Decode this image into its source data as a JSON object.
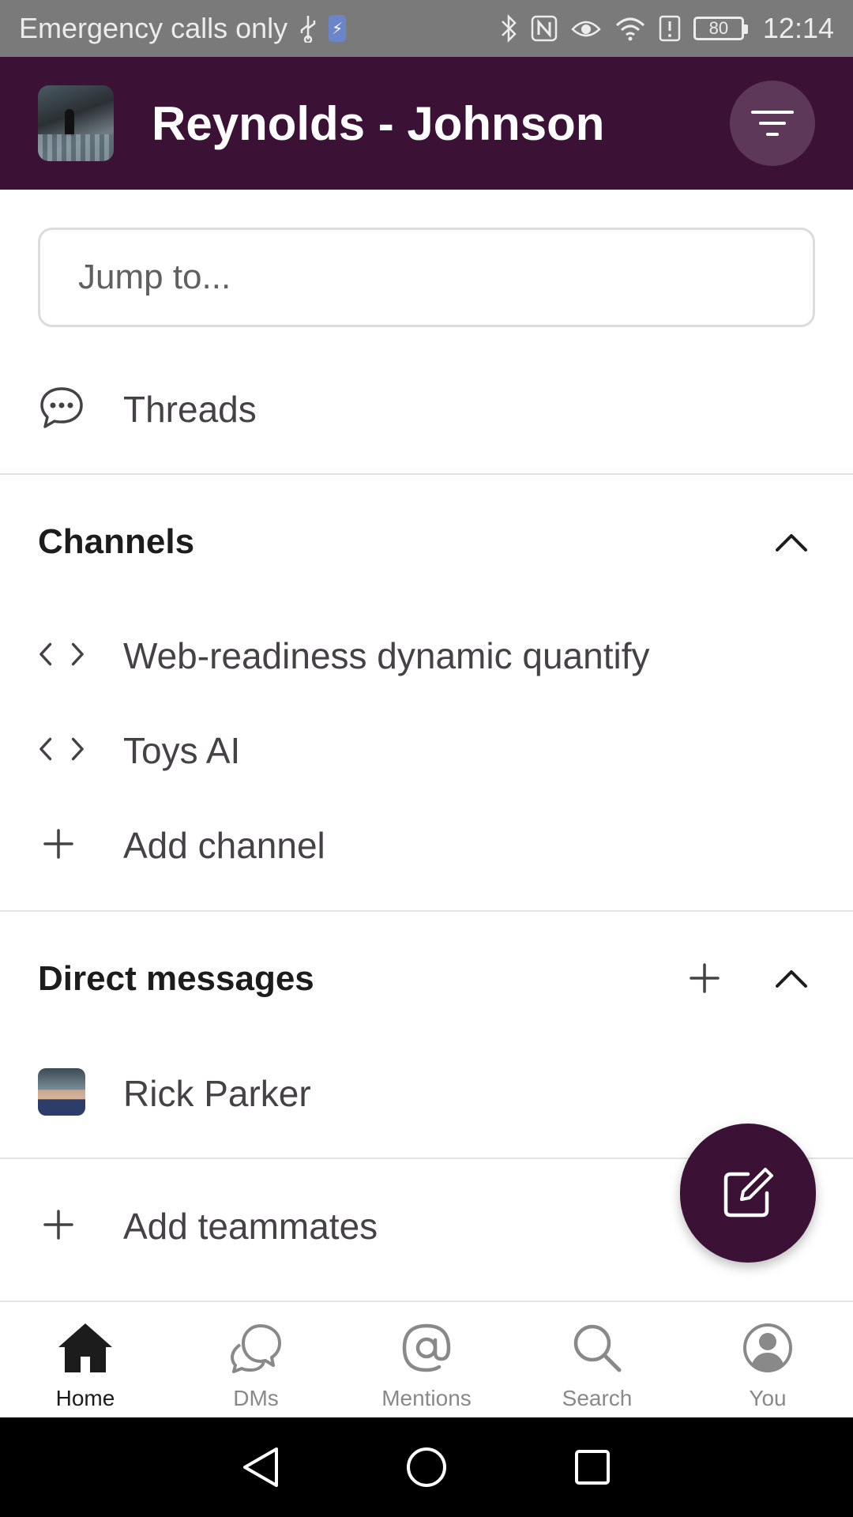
{
  "status_bar": {
    "carrier_text": "Emergency calls only",
    "battery_level": "80",
    "time": "12:14"
  },
  "header": {
    "workspace_name": "Reynolds - Johnson"
  },
  "search": {
    "placeholder": "Jump to..."
  },
  "threads": {
    "label": "Threads"
  },
  "channels": {
    "title": "Channels",
    "items": [
      {
        "label": "Web-readiness dynamic quantify"
      },
      {
        "label": "Toys AI"
      }
    ],
    "add_label": "Add channel"
  },
  "direct_messages": {
    "title": "Direct messages",
    "items": [
      {
        "label": "Rick Parker"
      }
    ]
  },
  "add_teammates": {
    "label": "Add teammates"
  },
  "bottom_nav": {
    "items": [
      {
        "label": "Home",
        "icon": "home-icon",
        "active": true
      },
      {
        "label": "DMs",
        "icon": "dms-icon"
      },
      {
        "label": "Mentions",
        "icon": "mentions-icon"
      },
      {
        "label": "Search",
        "icon": "search-icon"
      },
      {
        "label": "You",
        "icon": "profile-icon"
      }
    ]
  },
  "colors": {
    "header_bg": "#3b1236",
    "fab_bg": "#3b1236",
    "status_bar_bg": "#7a7a7a"
  }
}
